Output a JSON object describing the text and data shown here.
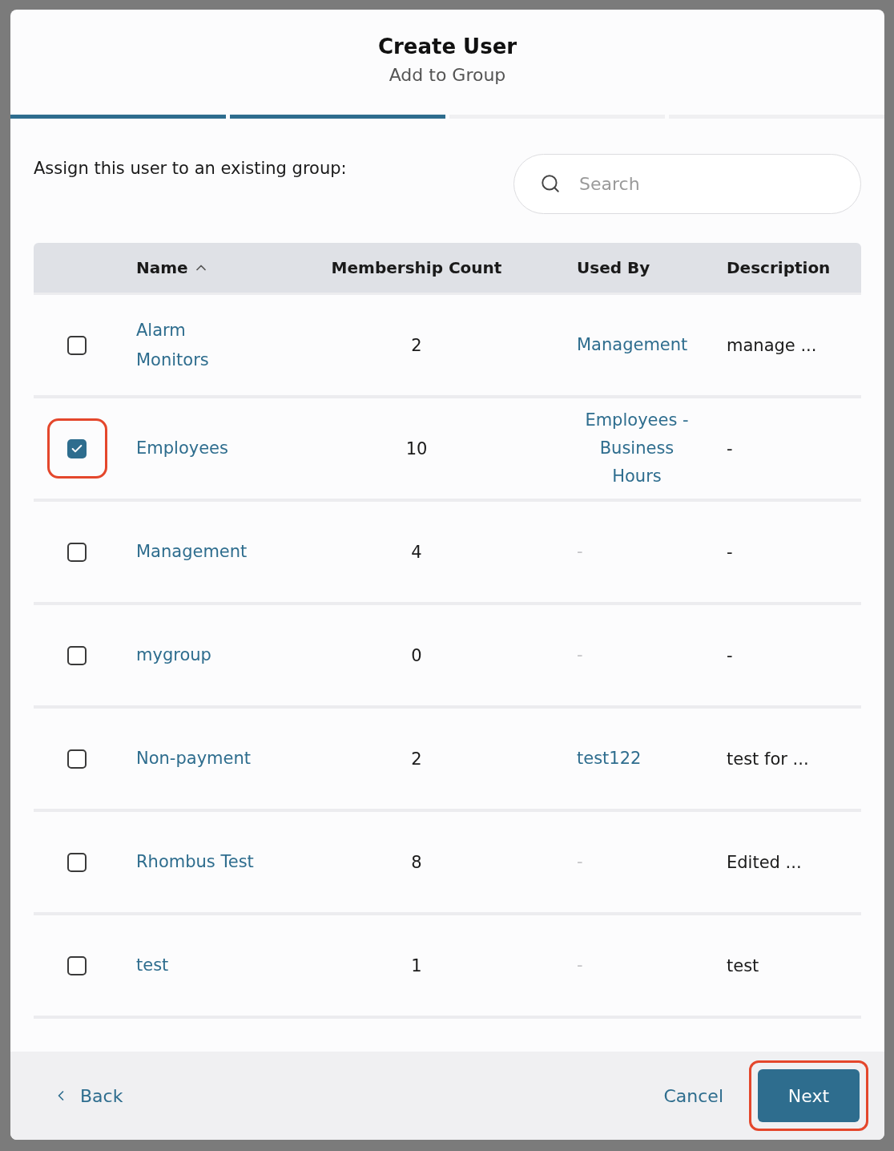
{
  "dialog": {
    "title": "Create User",
    "subtitle": "Add to Group"
  },
  "steps": [
    {
      "completed": true
    },
    {
      "completed": true
    },
    {
      "completed": false
    },
    {
      "completed": false
    }
  ],
  "prompt": "Assign this user to an existing group:",
  "search": {
    "placeholder": "Search"
  },
  "table": {
    "columns": [
      {
        "label": "Name",
        "sorted": true
      },
      {
        "label": "Membership Count",
        "sorted": false
      },
      {
        "label": "Used By",
        "sorted": false
      },
      {
        "label": "Description",
        "sorted": false
      }
    ],
    "rows": [
      {
        "checked": false,
        "highlighted": false,
        "name": "Alarm Monitors",
        "membership_count": "2",
        "used_by": {
          "text": "Management",
          "linked": true
        },
        "description": "manage ..."
      },
      {
        "checked": true,
        "highlighted": true,
        "name": "Employees",
        "membership_count": "10",
        "used_by": {
          "text": "Employees - Business Hours",
          "linked": true
        },
        "description": "-"
      },
      {
        "checked": false,
        "highlighted": false,
        "name": "Management",
        "membership_count": "4",
        "used_by": {
          "text": "-",
          "linked": false
        },
        "description": "-"
      },
      {
        "checked": false,
        "highlighted": false,
        "name": "mygroup",
        "membership_count": "0",
        "used_by": {
          "text": "-",
          "linked": false
        },
        "description": "-"
      },
      {
        "checked": false,
        "highlighted": false,
        "name": "Non-payment",
        "membership_count": "2",
        "used_by": {
          "text": "test122",
          "linked": true
        },
        "description": "test for ..."
      },
      {
        "checked": false,
        "highlighted": false,
        "name": "Rhombus Test",
        "membership_count": "8",
        "used_by": {
          "text": "-",
          "linked": false
        },
        "description": "Edited ..."
      },
      {
        "checked": false,
        "highlighted": false,
        "name": "test",
        "membership_count": "1",
        "used_by": {
          "text": "-",
          "linked": false
        },
        "description": "test"
      }
    ]
  },
  "footer": {
    "back": "Back",
    "cancel": "Cancel",
    "next": {
      "label": "Next",
      "highlighted": true
    }
  }
}
